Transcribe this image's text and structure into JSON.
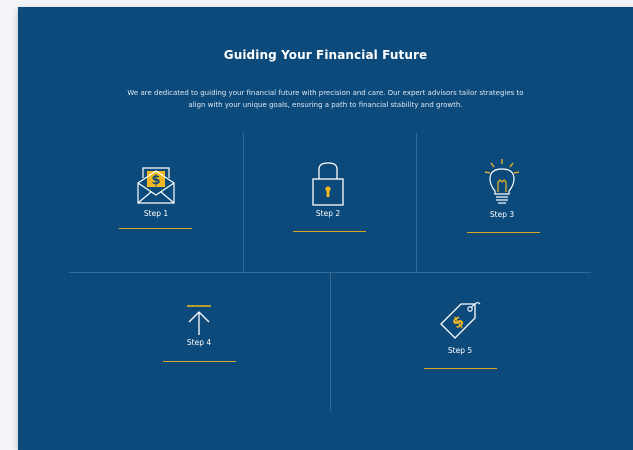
{
  "section": {
    "title": "Guiding Your Financial Future",
    "description": "We are dedicated to guiding your financial future with precision and care. Our expert advisors tailor strategies to align with your unique goals, ensuring a path to financial stability and growth."
  },
  "steps": [
    {
      "label": "Step 1",
      "icon": "envelope-dollar-icon"
    },
    {
      "label": "Step 2",
      "icon": "padlock-icon"
    },
    {
      "label": "Step 3",
      "icon": "lightbulb-icon"
    },
    {
      "label": "Step 4",
      "icon": "arrow-up-icon"
    },
    {
      "label": "Step 5",
      "icon": "price-tag-dollar-icon"
    }
  ],
  "colors": {
    "background": "#0d4a7c",
    "accent": "#f2b81e",
    "underline": "#d8a722",
    "text": "#ffffff",
    "page": "#f3f5f8"
  }
}
